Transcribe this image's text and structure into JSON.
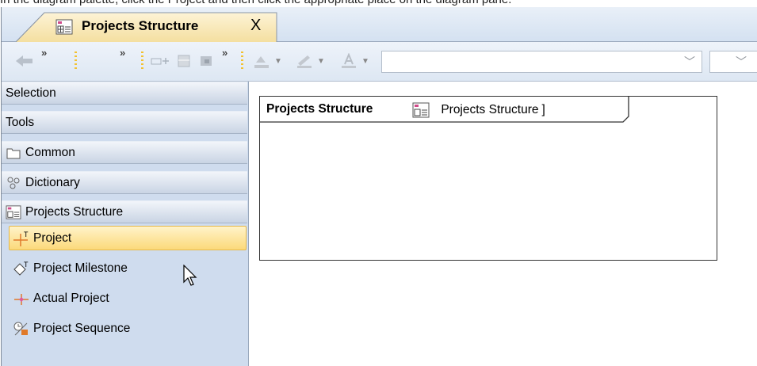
{
  "instruction": "In the diagram palette, click the Project and then click the appropriate place on the diagram pane.",
  "tab": {
    "title": "Projects Structure",
    "close_label": "X"
  },
  "toolbar": {
    "combo1_value": "",
    "combo2_value": ""
  },
  "palette": {
    "sections": [
      {
        "label": "Selection",
        "icon": ""
      },
      {
        "label": "Tools",
        "icon": ""
      },
      {
        "label": "Common",
        "icon": "folder-icon"
      },
      {
        "label": "Dictionary",
        "icon": "dictionary-icon"
      },
      {
        "label": "Projects Structure",
        "icon": "projects-structure-icon"
      }
    ],
    "items": [
      {
        "label": "Project",
        "icon": "project-icon",
        "selected": true
      },
      {
        "label": "Project Milestone",
        "icon": "project-milestone-icon",
        "selected": false
      },
      {
        "label": "Actual Project",
        "icon": "actual-project-icon",
        "selected": false
      },
      {
        "label": "Project Sequence",
        "icon": "project-sequence-icon",
        "selected": false
      }
    ]
  },
  "diagram": {
    "frame_title": "Projects Structure",
    "frame_ref_open": "[",
    "frame_ref_name": "Projects Structure",
    "frame_ref_close": "]"
  },
  "colors": {
    "palette_bg": "#cfdcee",
    "selected_item": "#fbd97a",
    "accent_grip": "#f2c232"
  }
}
